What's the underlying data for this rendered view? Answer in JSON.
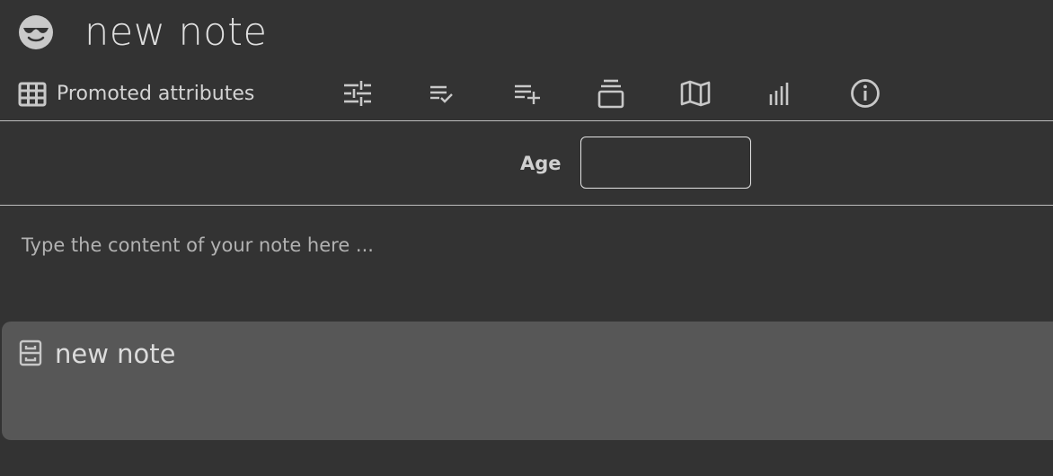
{
  "note": {
    "title": "new note",
    "icon": "smiling-face-with-sunglasses-icon"
  },
  "ribbon": {
    "active_tab_label": "Promoted attributes",
    "active_tab_icon": "grid-table-icon",
    "buttons": [
      {
        "name": "settings-sliders-icon",
        "label": ""
      },
      {
        "name": "checklist-icon",
        "label": ""
      },
      {
        "name": "list-add-icon",
        "label": ""
      },
      {
        "name": "stack-icon",
        "label": ""
      },
      {
        "name": "map-icon",
        "label": ""
      },
      {
        "name": "bar-chart-icon",
        "label": ""
      },
      {
        "name": "info-icon",
        "label": ""
      }
    ]
  },
  "promoted_attributes": [
    {
      "label": "Age",
      "value": "",
      "placeholder": ""
    }
  ],
  "content": {
    "placeholder": "Type the content of your note here ..."
  },
  "children": [
    {
      "title": "new note",
      "icon": "archive-drawer-icon"
    }
  ],
  "colors": {
    "background": "#333333",
    "card": "#575757",
    "icon": "#c8c8c8",
    "divider": "#bdbdbd"
  }
}
